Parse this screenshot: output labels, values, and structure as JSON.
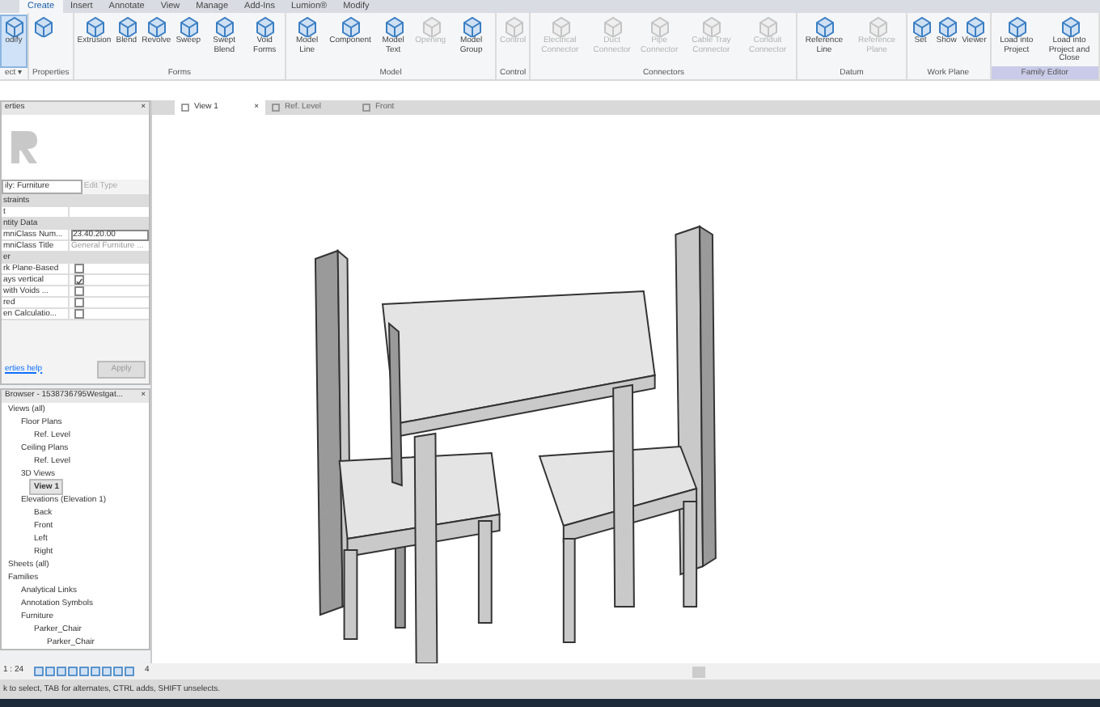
{
  "menu_tabs": [
    {
      "label": "Create",
      "selected": true
    },
    {
      "label": "Insert",
      "selected": false
    },
    {
      "label": "Annotate",
      "selected": false
    },
    {
      "label": "View",
      "selected": false
    },
    {
      "label": "Manage",
      "selected": false
    },
    {
      "label": "Add-Ins",
      "selected": false
    },
    {
      "label": "Lumion®",
      "selected": false
    },
    {
      "label": "Modify",
      "selected": false
    }
  ],
  "ribbon": [
    {
      "title": "ect ▾",
      "highlight": false,
      "tools": [
        {
          "label": "odify",
          "disabled": false,
          "selected": true
        }
      ]
    },
    {
      "title": "Properties",
      "highlight": false,
      "tools": [
        {
          "disabled": false,
          "selected": false
        }
      ]
    },
    {
      "title": "Forms",
      "highlight": false,
      "tools": [
        {
          "label": "Extrusion",
          "disabled": false,
          "selected": false
        },
        {
          "label": "Blend",
          "disabled": false,
          "selected": false
        },
        {
          "label": "Revolve",
          "disabled": false,
          "selected": false
        },
        {
          "label": "Sweep",
          "disabled": false,
          "selected": false
        },
        {
          "label": "Swept Blend",
          "disabled": false,
          "selected": false
        },
        {
          "label": "Void Forms",
          "disabled": false,
          "selected": false
        }
      ]
    },
    {
      "title": "Model",
      "highlight": false,
      "tools": [
        {
          "label": "Model Line",
          "disabled": false,
          "selected": false
        },
        {
          "label": "Component",
          "disabled": false,
          "selected": false
        },
        {
          "label": "Model Text",
          "disabled": false,
          "selected": false
        },
        {
          "label": "Opening",
          "disabled": true,
          "selected": false
        },
        {
          "label": "Model Group",
          "disabled": false,
          "selected": false
        }
      ]
    },
    {
      "title": "Control",
      "highlight": false,
      "tools": [
        {
          "label": "Control",
          "disabled": true,
          "selected": false
        }
      ]
    },
    {
      "title": "Connectors",
      "highlight": false,
      "tools": [
        {
          "label": "Electrical Connector",
          "disabled": true,
          "selected": false
        },
        {
          "label": "Duct Connector",
          "disabled": true,
          "selected": false
        },
        {
          "label": "Pipe Connector",
          "disabled": true,
          "selected": false
        },
        {
          "label": "Cable Tray Connector",
          "disabled": true,
          "selected": false
        },
        {
          "label": "Conduit Connector",
          "disabled": true,
          "selected": false
        }
      ]
    },
    {
      "title": "Datum",
      "highlight": false,
      "tools": [
        {
          "label": "Reference Line",
          "disabled": false,
          "selected": false
        },
        {
          "label": "Reference Plane",
          "disabled": true,
          "selected": false
        }
      ]
    },
    {
      "title": "Work Plane",
      "highlight": false,
      "tools": [
        {
          "label": "Set",
          "disabled": false,
          "selected": false
        },
        {
          "label": "Show",
          "disabled": false,
          "selected": false
        },
        {
          "label": "Viewer",
          "disabled": false,
          "selected": false
        }
      ]
    },
    {
      "title": "Family Editor",
      "highlight": true,
      "tools": [
        {
          "label": "Load into Project",
          "disabled": false,
          "selected": false
        },
        {
          "label": "Load into Project and Close",
          "disabled": false,
          "selected": false
        }
      ]
    }
  ],
  "properties": {
    "title": "erties",
    "close": "×",
    "type_selector": "ily: Furniture",
    "edit_type": "Edit Type",
    "groups": [
      {
        "title": "straints",
        "rows": [
          {
            "kind": "text",
            "name": "t",
            "value": ""
          }
        ]
      },
      {
        "title": "ntity Data",
        "rows": [
          {
            "kind": "field",
            "name": "mniClass Num...",
            "value": "23.40.20.00"
          },
          {
            "kind": "text",
            "name": "mniClass Title",
            "value": "General Furniture ..."
          }
        ]
      },
      {
        "title": "er",
        "rows": [
          {
            "kind": "checkbox",
            "name": "rk Plane-Based",
            "checked": false
          },
          {
            "kind": "checkbox",
            "name": "ays vertical",
            "checked": true
          },
          {
            "kind": "checkbox",
            "name": "with Voids ...",
            "checked": false
          },
          {
            "kind": "checkbox",
            "name": "red",
            "checked": false
          },
          {
            "kind": "checkbox",
            "name": "en Calculatio...",
            "checked": false
          }
        ]
      }
    ],
    "help_link": "erties help",
    "apply": "Apply"
  },
  "browser": {
    "title": "Browser - 1538736795Westgat...",
    "close": "×",
    "tree": [
      {
        "label": "Views (all)",
        "selected": false,
        "children": [
          {
            "label": "Floor Plans",
            "selected": false,
            "children": [
              {
                "label": "Ref. Level",
                "selected": false
              }
            ]
          },
          {
            "label": "Ceiling Plans",
            "selected": false,
            "children": [
              {
                "label": "Ref. Level",
                "selected": false
              }
            ]
          },
          {
            "label": "3D Views",
            "selected": false,
            "children": [
              {
                "label": "View 1",
                "selected": true
              }
            ]
          },
          {
            "label": "Elevations (Elevation 1)",
            "selected": false,
            "children": [
              {
                "label": "Back",
                "selected": false
              },
              {
                "label": "Front",
                "selected": false
              },
              {
                "label": "Left",
                "selected": false
              },
              {
                "label": "Right",
                "selected": false
              }
            ]
          }
        ]
      },
      {
        "label": "Sheets (all)",
        "selected": false
      },
      {
        "label": "Families",
        "selected": false,
        "children": [
          {
            "label": "Analytical Links",
            "selected": false
          },
          {
            "label": "Annotation Symbols",
            "selected": false
          },
          {
            "label": "Furniture",
            "selected": false,
            "children": [
              {
                "label": "Parker_Chair",
                "selected": false,
                "children": [
                  {
                    "label": "Parker_Chair",
                    "selected": false
                  }
                ]
              }
            ]
          }
        ]
      }
    ]
  },
  "view_tabs": [
    {
      "label": "View 1",
      "selected": true,
      "close": "×"
    },
    {
      "label": "Ref. Level",
      "selected": false
    },
    {
      "label": "Front",
      "selected": false
    }
  ],
  "view_bar": {
    "scale": "1 : 24",
    "more": "4"
  },
  "status_bar": "k to select, TAB for alternates, CTRL adds, SHIFT unselects."
}
